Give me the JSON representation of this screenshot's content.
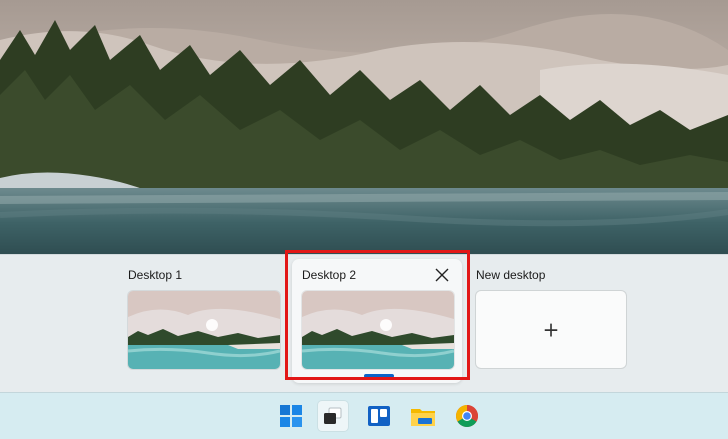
{
  "desktops": [
    {
      "label": "Desktop 1",
      "active": false
    },
    {
      "label": "Desktop 2",
      "active": true
    }
  ],
  "new_desktop": {
    "label": "New desktop",
    "plus": "+"
  },
  "taskbar": {
    "icons": [
      "windows-start-icon",
      "task-view-icon",
      "widgets-icon",
      "file-explorer-icon",
      "chrome-icon"
    ]
  },
  "colors": {
    "highlight": "#e21717",
    "active_indicator": "#0a63c9",
    "taskbar_bg": "#d6ecf1",
    "taskview_bg": "#e7ecee"
  }
}
